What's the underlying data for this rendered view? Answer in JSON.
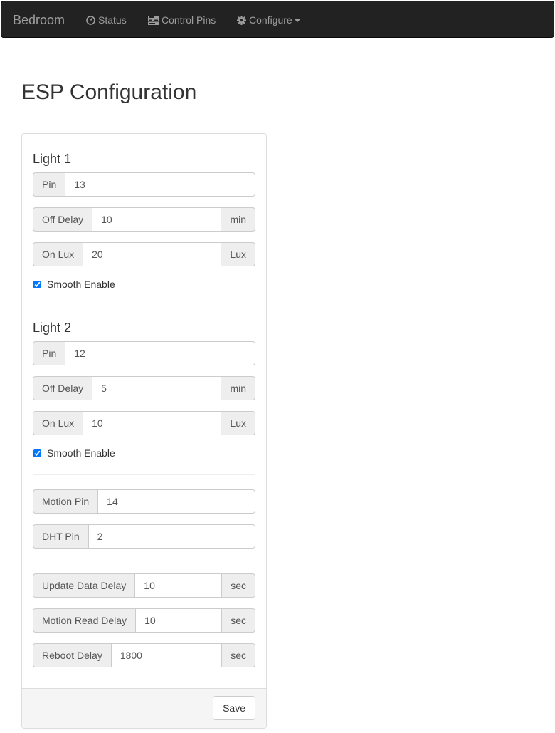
{
  "nav": {
    "brand": "Bedroom",
    "items": [
      {
        "label": "Status",
        "icon": "dashboard-icon"
      },
      {
        "label": "Control Pins",
        "icon": "tasks-icon"
      },
      {
        "label": "Configure",
        "icon": "gear-icon",
        "dropdown": true
      }
    ]
  },
  "page": {
    "title": "ESP Configuration"
  },
  "light1": {
    "title": "Light 1",
    "pin_label": "Pin",
    "pin": "13",
    "off_delay_label": "Off Delay",
    "off_delay": "10",
    "off_delay_unit": "min",
    "on_lux_label": "On Lux",
    "on_lux": "20",
    "on_lux_unit": "Lux",
    "smooth_label": "Smooth Enable",
    "smooth_checked": true
  },
  "light2": {
    "title": "Light 2",
    "pin_label": "Pin",
    "pin": "12",
    "off_delay_label": "Off Delay",
    "off_delay": "5",
    "off_delay_unit": "min",
    "on_lux_label": "On Lux",
    "on_lux": "10",
    "on_lux_unit": "Lux",
    "smooth_label": "Smooth Enable",
    "smooth_checked": true
  },
  "sensors": {
    "motion_pin_label": "Motion Pin",
    "motion_pin": "14",
    "dht_pin_label": "DHT Pin",
    "dht_pin": "2"
  },
  "delays": {
    "update_label": "Update Data Delay",
    "update": "10",
    "update_unit": "sec",
    "motion_read_label": "Motion Read Delay",
    "motion_read": "10",
    "motion_read_unit": "sec",
    "reboot_label": "Reboot Delay",
    "reboot": "1800",
    "reboot_unit": "sec"
  },
  "footer": {
    "save_label": "Save"
  },
  "colors": {
    "navbar_bg": "#222222",
    "nav_text": "#9d9d9d",
    "addon_bg": "#eeeeee",
    "border": "#cccccc"
  }
}
